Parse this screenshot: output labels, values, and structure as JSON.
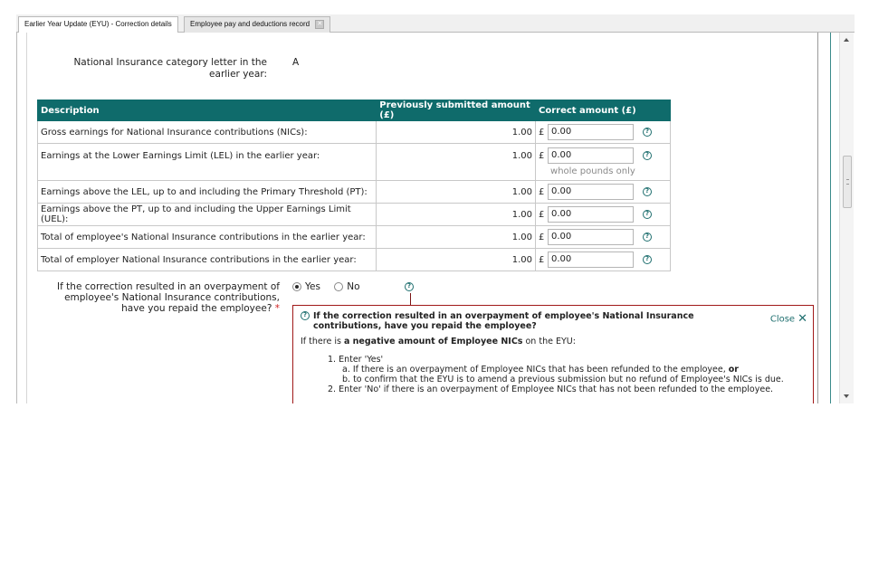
{
  "tabs": [
    {
      "label": "Earlier Year Update (EYU) - Correction details"
    },
    {
      "label": "Employee pay and deductions record"
    }
  ],
  "category": {
    "label": "National Insurance category letter in the earlier year:",
    "value": "A"
  },
  "table": {
    "headers": [
      "Description",
      "Previously submitted amount (£)",
      "Correct amount (£)"
    ],
    "rows": [
      {
        "description": "Gross earnings for National Insurance contributions (NICs):",
        "previous": "1.00",
        "currency": "£",
        "correct": "0.00"
      },
      {
        "description": "Earnings at the Lower Earnings Limit (LEL) in the earlier year:",
        "previous": "1.00",
        "currency": "£",
        "correct": "0.00",
        "hint": "whole pounds only"
      },
      {
        "description": "Earnings above the LEL, up to and including the Primary Threshold (PT):",
        "previous": "1.00",
        "currency": "£",
        "correct": "0.00"
      },
      {
        "description": "Earnings above the PT, up to and including the Upper Earnings Limit (UEL):",
        "previous": "1.00",
        "currency": "£",
        "correct": "0.00"
      },
      {
        "description": "Total of employee's National Insurance contributions in the earlier year:",
        "previous": "1.00",
        "currency": "£",
        "correct": "0.00"
      },
      {
        "description": "Total of employer National Insurance contributions in the earlier year:",
        "previous": "1.00",
        "currency": "£",
        "correct": "0.00"
      }
    ]
  },
  "question": {
    "label": "If the correction resulted in an overpayment of employee's National Insurance contributions, have you repaid the employee?",
    "required_mark": "*",
    "options": [
      "Yes",
      "No"
    ],
    "selected": "Yes"
  },
  "help": {
    "title": "If the correction resulted in an overpayment of employee's National Insurance contributions, have you repaid the employee?",
    "close_label": "Close",
    "intro_pre": "If there is ",
    "intro_bold": "a negative amount of Employee NICs",
    "intro_post": " on the EYU:",
    "item1": "1. Enter 'Yes'",
    "item1a_pre": "a. If there is an overpayment of Employee NICs that has been refunded to the employee, ",
    "item1a_bold": "or",
    "item1b": "b. to confirm that the EYU is to amend a previous submission but no refund of Employee's NICs is due.",
    "item2": "2. Enter 'No' if there is an overpayment of Employee NICs that has not been refunded to the employee."
  },
  "colors": {
    "header_bg": "#0f6b6b",
    "help_border": "#a01818",
    "accent": "#1f6f6f"
  },
  "icons": [
    "help-icon",
    "close-icon",
    "tab-close-icon"
  ]
}
